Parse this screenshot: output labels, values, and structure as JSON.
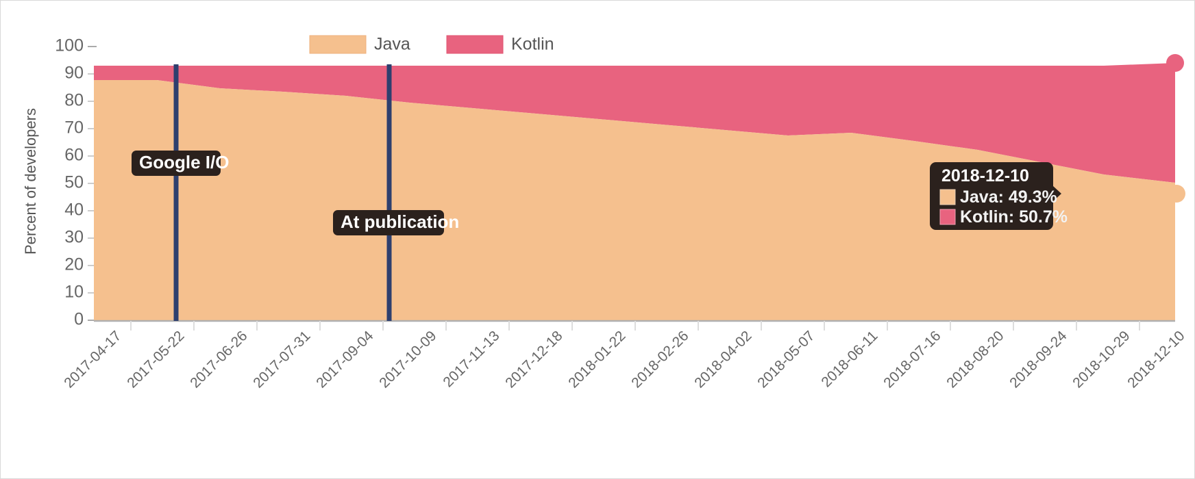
{
  "chart_data": {
    "type": "area",
    "stacked": true,
    "title": "",
    "subtitle": "",
    "xlabel": "",
    "ylabel": "Percent of developers",
    "ylim": [
      0,
      100
    ],
    "ytick_labels": [
      "100",
      "90",
      "80",
      "70",
      "60",
      "50",
      "40",
      "30",
      "20",
      "10",
      "0"
    ],
    "ytick_values": [
      100,
      90,
      80,
      70,
      60,
      50,
      40,
      30,
      20,
      10,
      0
    ],
    "grid": false,
    "legend_position": "top-center",
    "legend": [
      "Java",
      "Kotlin"
    ],
    "categories": [
      "2017-04-17",
      "2017-05-22",
      "2017-06-26",
      "2017-07-31",
      "2017-09-04",
      "2017-10-09",
      "2017-11-13",
      "2017-12-18",
      "2018-01-22",
      "2018-02-26",
      "2018-04-02",
      "2018-05-07",
      "2018-06-11",
      "2018-07-16",
      "2018-08-20",
      "2018-09-24",
      "2018-10-29",
      "2018-12-10"
    ],
    "series": [
      {
        "name": "Java",
        "color": "#f5c08e",
        "values": [
          88.0,
          88.0,
          85.0,
          84.0,
          82.5,
          81.0,
          79.5,
          78.0,
          76.5,
          75.0,
          73.5,
          71.5,
          69.0,
          66.0,
          63.0,
          58.0,
          53.5,
          49.3
        ]
      },
      {
        "name": "Kotlin",
        "color": "#e8637f",
        "values": [
          5.0,
          5.0,
          8.0,
          9.0,
          10.5,
          12.0,
          13.5,
          15.0,
          16.5,
          18.0,
          19.5,
          21.5,
          24.0,
          27.0,
          30.0,
          35.0,
          39.5,
          50.7
        ]
      }
    ],
    "stack_top_values": [
      93.0,
      93.0,
      93.0,
      93.0,
      93.0,
      93.0,
      93.0,
      93.0,
      93.0,
      93.0,
      93.0,
      93.0,
      93.0,
      93.0,
      93.0,
      93.0,
      93.0,
      100.0
    ]
  },
  "legend": {
    "items": [
      {
        "label": "Java",
        "color": "#f5c08e"
      },
      {
        "label": "Kotlin",
        "color": "#e8637f"
      }
    ]
  },
  "axes": {
    "y_title": "Percent of developers",
    "y_ticks": [
      "100",
      "90",
      "80",
      "70",
      "60",
      "50",
      "40",
      "30",
      "20",
      "10",
      "0"
    ],
    "x_ticks": [
      "2017-04-17",
      "2017-05-22",
      "2017-06-26",
      "2017-07-31",
      "2017-09-04",
      "2017-10-09",
      "2017-11-13",
      "2017-12-18",
      "2018-01-22",
      "2018-02-26",
      "2018-04-02",
      "2018-05-07",
      "2018-06-11",
      "2018-07-16",
      "2018-08-20",
      "2018-09-24",
      "2018-10-29",
      "2018-12-10"
    ]
  },
  "annotations": [
    {
      "label": "Google I/O",
      "x_value": "2017-05-10",
      "color": "#2e3f6e"
    },
    {
      "label": "At publication",
      "x_value": "2017-09-25",
      "color": "#2e3f6e"
    }
  ],
  "tooltip": {
    "date": "2018-12-10",
    "rows": [
      {
        "label": "Java: 49.3%",
        "color": "#f5c08e"
      },
      {
        "label": "Kotlin: 50.7%",
        "color": "#e8637f"
      }
    ]
  },
  "colors": {
    "java": "#f5c08e",
    "kotlin": "#e8637f",
    "annotation_line": "#2e3f6e",
    "tooltip_background": "#2b211d",
    "axis": "#999999",
    "text": "#666666"
  }
}
